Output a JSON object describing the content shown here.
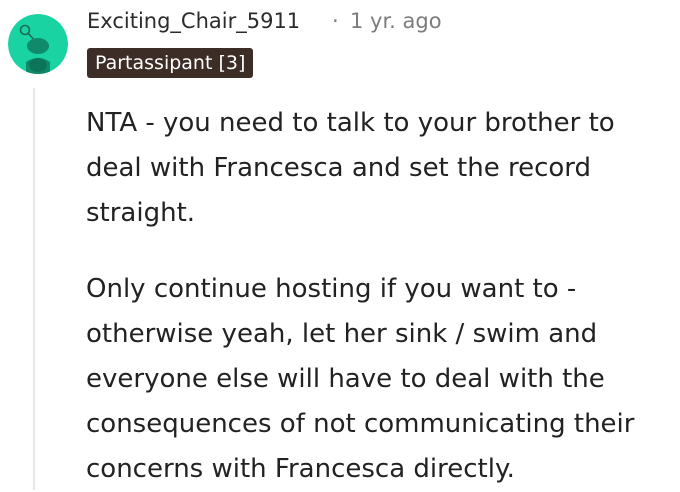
{
  "comment": {
    "author": "Exciting_Chair_5911",
    "separator": "·",
    "timestamp": "1 yr. ago",
    "flair": "Partassipant [3]",
    "paragraphs": [
      "NTA - you need to talk to your brother to deal with Francesca and set the record straight.",
      "Only continue hosting if you want to - otherwise yeah, let her sink / swim and everyone else will have to deal with the consequences of not communicating their concerns with Francesca directly."
    ],
    "avatar_icon": "snoo-avatar-icon",
    "colors": {
      "avatar_bg": "#19d3a2",
      "flair_bg": "#3c2e26",
      "flair_text": "#ffffff",
      "meta_text": "#7c7c7c",
      "thread_line": "#e4e6e8"
    }
  }
}
